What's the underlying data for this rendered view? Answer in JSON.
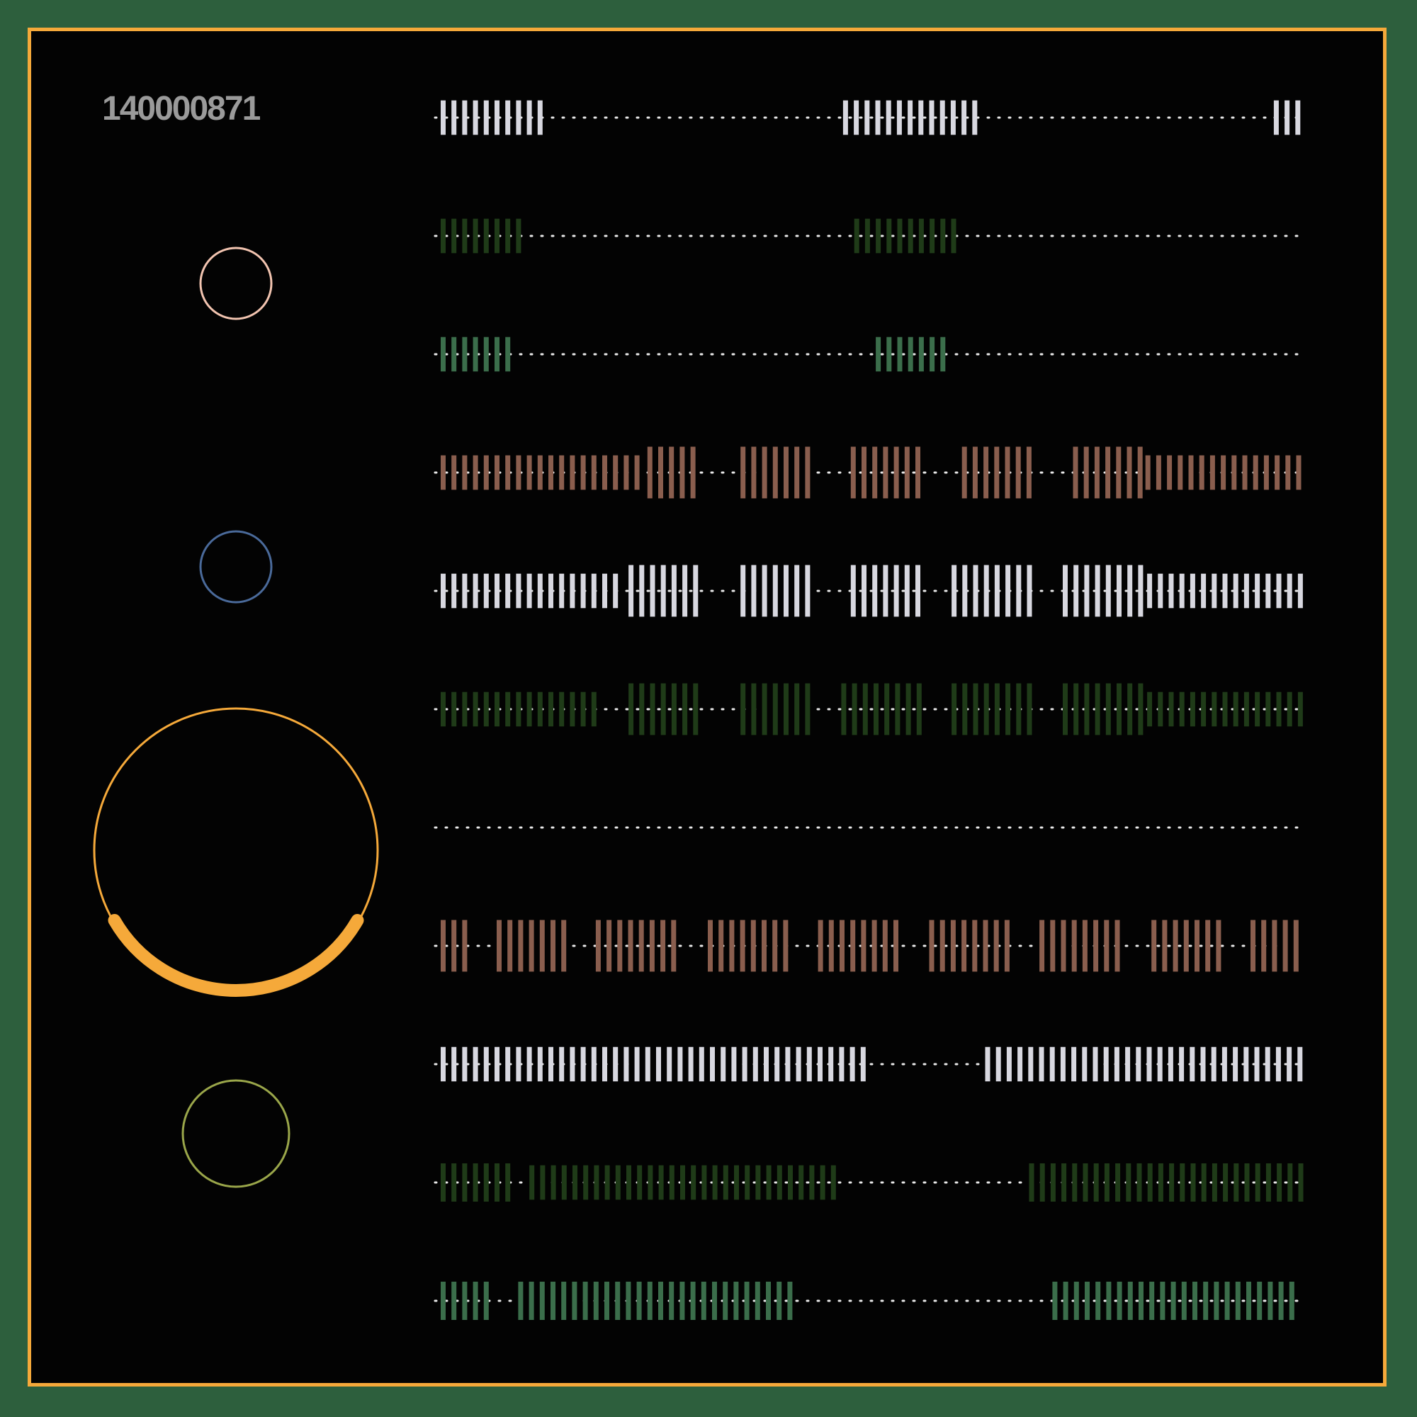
{
  "id_label": "140000871",
  "colors": {
    "background": "#2d5f3d",
    "panel": "#030303",
    "frame": "#f5a93a",
    "label": "#9a9a9a",
    "dots": "#e8e8e8"
  },
  "palette": {
    "white": "#d8d8e0",
    "dark_green": "#1f3b18",
    "green": "#3b6e4b",
    "brown": "#8a5e4e"
  },
  "circles": [
    {
      "name": "pink-ring",
      "color": "#f2c4b0",
      "size": "small"
    },
    {
      "name": "blue-ring",
      "color": "#4a6a9a",
      "size": "small"
    },
    {
      "name": "orange-ring",
      "color": "#f5a93a",
      "size": "large",
      "arc_start_deg": 30,
      "arc_end_deg": 150
    },
    {
      "name": "olive-ring",
      "color": "#9aa64a",
      "size": "medium"
    }
  ],
  "rows": [
    {
      "color": "white",
      "segments": [
        [
          0,
          0.122,
          0.36
        ],
        [
          0.467,
          0.63,
          0.36
        ],
        [
          0.967,
          1.0,
          0.36
        ]
      ]
    },
    {
      "color": "dark_green",
      "segments": [
        [
          0,
          0.095,
          0.36
        ],
        [
          0.48,
          0.605,
          0.36
        ],
        [
          0.997,
          1.0,
          0.36
        ]
      ]
    },
    {
      "color": "green",
      "segments": [
        [
          0,
          0.083,
          0.36
        ],
        [
          0.505,
          0.588,
          0.36
        ]
      ]
    },
    {
      "color": "brown",
      "segments": [
        [
          0,
          0.24,
          0.36
        ],
        [
          0.24,
          0.305,
          0.54
        ],
        [
          0.348,
          0.432,
          0.54
        ],
        [
          0.476,
          0.56,
          0.54
        ],
        [
          0.605,
          0.69,
          0.54
        ],
        [
          0.734,
          0.818,
          0.54
        ],
        [
          0.818,
          1.0,
          0.36
        ]
      ]
    },
    {
      "color": "white",
      "segments": [
        [
          0,
          0.213,
          0.36
        ],
        [
          0.218,
          0.305,
          0.54
        ],
        [
          0.348,
          0.432,
          0.54
        ],
        [
          0.476,
          0.56,
          0.54
        ],
        [
          0.593,
          0.69,
          0.54
        ],
        [
          0.722,
          0.818,
          0.54
        ],
        [
          0.82,
          1.0,
          0.36
        ]
      ]
    },
    {
      "color": "dark_green",
      "segments": [
        [
          0,
          0.188,
          0.36
        ],
        [
          0.218,
          0.305,
          0.54
        ],
        [
          0.348,
          0.432,
          0.54
        ],
        [
          0.465,
          0.56,
          0.54
        ],
        [
          0.593,
          0.69,
          0.54
        ],
        [
          0.722,
          0.818,
          0.54
        ],
        [
          0.82,
          1.0,
          0.36
        ]
      ]
    },
    {
      "color": "white",
      "segments": []
    },
    {
      "color": "brown",
      "segments": [
        [
          0,
          0.035,
          0.54
        ],
        [
          0.065,
          0.15,
          0.54
        ],
        [
          0.18,
          0.277,
          0.54
        ],
        [
          0.31,
          0.405,
          0.54
        ],
        [
          0.438,
          0.535,
          0.54
        ],
        [
          0.567,
          0.665,
          0.54
        ],
        [
          0.695,
          0.793,
          0.54
        ],
        [
          0.825,
          0.91,
          0.54
        ],
        [
          0.94,
          1.0,
          0.54
        ]
      ]
    },
    {
      "color": "white",
      "segments": [
        [
          0,
          0.125,
          0.36
        ],
        [
          0.125,
          0.5,
          0.36
        ],
        [
          0.632,
          1.0,
          0.36
        ]
      ]
    },
    {
      "color": "dark_green",
      "segments": [
        [
          0,
          0.085,
          0.4
        ],
        [
          0.103,
          0.46,
          0.36
        ],
        [
          0.683,
          1.0,
          0.4
        ]
      ]
    },
    {
      "color": "green",
      "segments": [
        [
          0,
          0.06,
          0.4
        ],
        [
          0.09,
          0.41,
          0.4
        ],
        [
          0.71,
          1.0,
          0.4
        ]
      ]
    }
  ]
}
